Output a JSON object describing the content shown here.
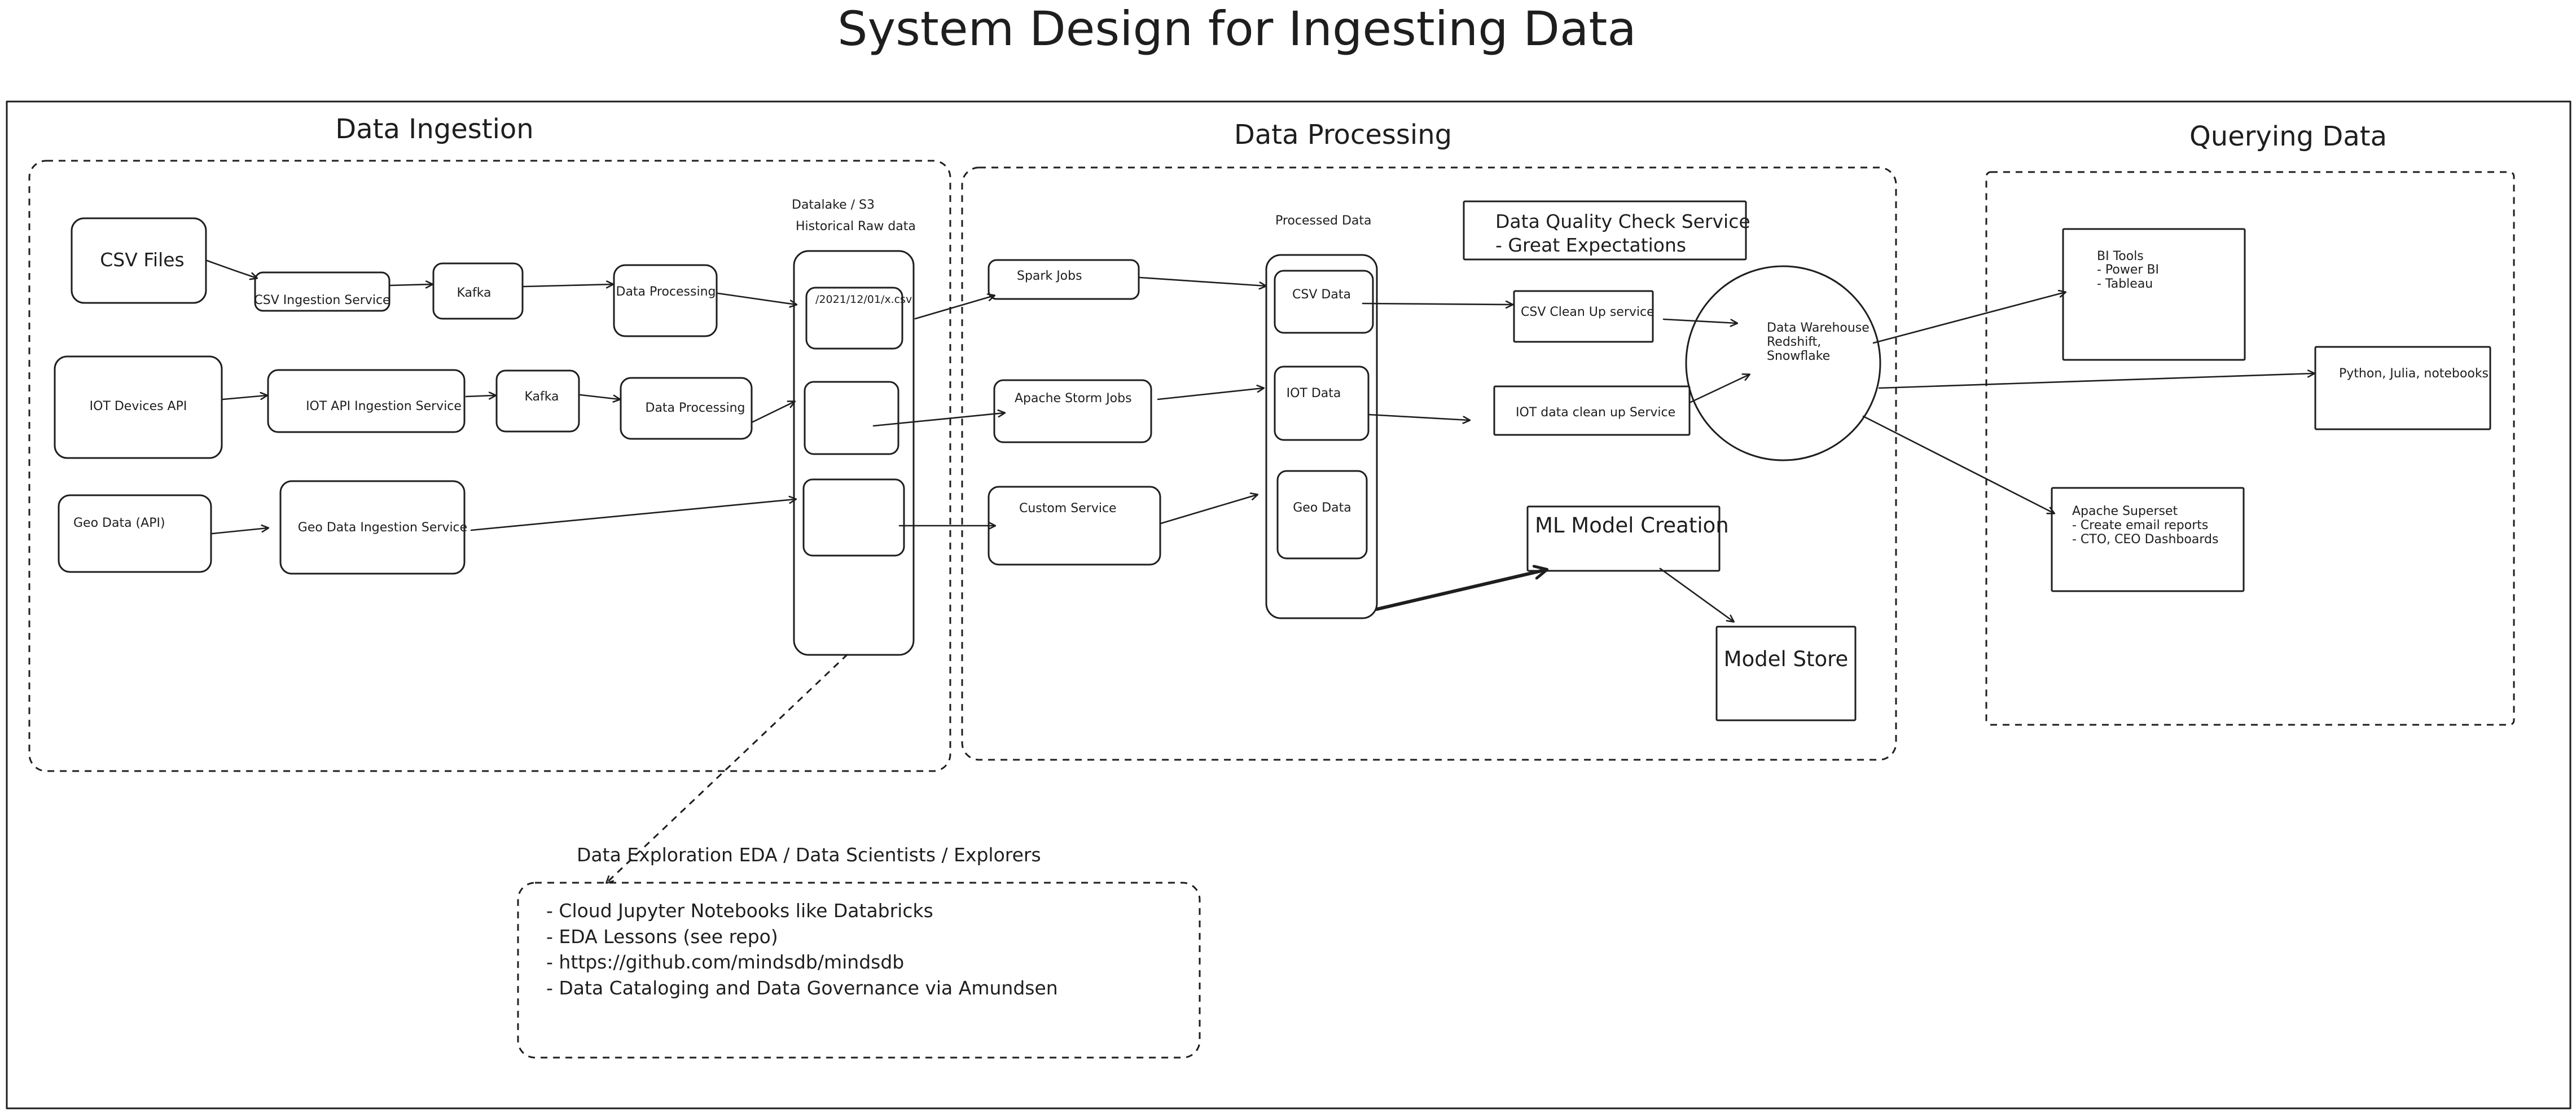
{
  "title": "System Design for Ingesting Data",
  "sections": {
    "ingestion": "Data Ingestion",
    "processing": "Data Processing",
    "querying": "Querying Data"
  },
  "ingestion": {
    "csv_files": "CSV Files",
    "csv_ingestion_service": "CSV Ingestion Service",
    "kafka_1": "Kafka",
    "data_processing_1": "Data Processing",
    "iot_devices_api": "IOT Devices API",
    "iot_api_ingestion_service": "IOT API Ingestion Service",
    "kafka_2": "Kafka",
    "data_processing_2": "Data Processing",
    "geo_data_api": "Geo Data (API)",
    "geo_data_ingestion_service": "Geo Data Ingestion Service",
    "datalake_label_1": "Datalake / S3",
    "datalake_label_2": "Historical Raw data",
    "datalake_file": "/2021/12/01/x.csv"
  },
  "processing": {
    "spark_jobs": "Spark Jobs",
    "apache_storm_jobs": "Apache Storm Jobs",
    "custom_service": "Custom Service",
    "processed_data": "Processed Data",
    "csv_data": "CSV Data",
    "iot_data": "IOT Data",
    "geo_data": "Geo Data",
    "quality_line_1": "Data Quality Check Service",
    "quality_line_2": "- Great Expectations",
    "csv_cleanup": "CSV Clean Up service",
    "iot_cleanup": "IOT data clean up Service",
    "warehouse_1": "Data Warehouse",
    "warehouse_2": "Redshift,",
    "warehouse_3": "Snowflake",
    "ml_model_creation": "ML Model Creation",
    "model_store": "Model Store"
  },
  "querying": {
    "bi_tools_1": "BI Tools",
    "bi_tools_2": "- Power BI",
    "bi_tools_3": "- Tableau",
    "notebooks": "Python, Julia, notebooks",
    "superset_1": "Apache Superset",
    "superset_2": "- Create email reports",
    "superset_3": "- CTO, CEO Dashboards"
  },
  "exploration": {
    "heading": "Data Exploration EDA / Data Scientists / Explorers",
    "items": [
      "- Cloud Jupyter Notebooks like Databricks",
      "- EDA Lessons (see repo)",
      "- https://github.com/mindsdb/mindsdb",
      "- Data Cataloging and Data Governance via Amundsen"
    ]
  }
}
